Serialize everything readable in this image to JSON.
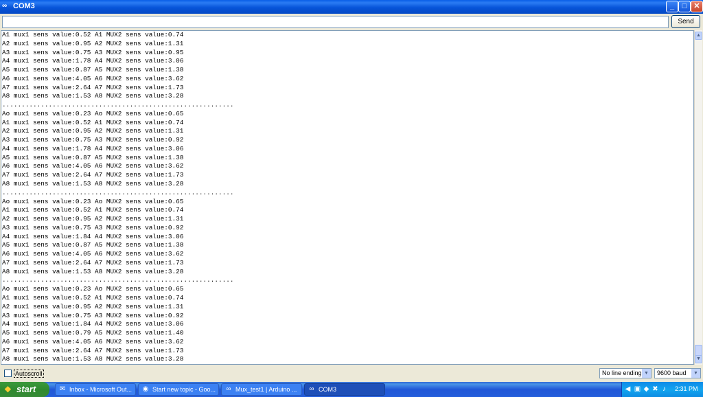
{
  "window": {
    "title": "COM3",
    "app_icon": "∞",
    "min_label": "_",
    "max_label": "□",
    "close_label": "✕"
  },
  "send_row": {
    "input_value": "",
    "send_label": "Send"
  },
  "output_lines": [
    "A1 mux1 sens value:0.52 A1 MUX2 sens value:0.74",
    "A2 mux1 sens value:0.95 A2 MUX2 sens value:1.31",
    "A3 mux1 sens value:0.75 A3 MUX2 sens value:0.95",
    "A4 mux1 sens value:1.78 A4 MUX2 sens value:3.06",
    "A5 mux1 sens value:0.87 A5 MUX2 sens value:1.38",
    "A6 mux1 sens value:4.05 A6 MUX2 sens value:3.62",
    "A7 mux1 sens value:2.64 A7 MUX2 sens value:1.73",
    "A8 mux1 sens value:1.53 A8 MUX2 sens value:3.28",
    "............................................................",
    "Ao mux1 sens value:0.23 Ao MUX2 sens value:0.65",
    "A1 mux1 sens value:0.52 A1 MUX2 sens value:0.74",
    "A2 mux1 sens value:0.95 A2 MUX2 sens value:1.31",
    "A3 mux1 sens value:0.75 A3 MUX2 sens value:0.92",
    "A4 mux1 sens value:1.78 A4 MUX2 sens value:3.06",
    "A5 mux1 sens value:0.87 A5 MUX2 sens value:1.38",
    "A6 mux1 sens value:4.05 A6 MUX2 sens value:3.62",
    "A7 mux1 sens value:2.64 A7 MUX2 sens value:1.73",
    "A8 mux1 sens value:1.53 A8 MUX2 sens value:3.28",
    "............................................................",
    "Ao mux1 sens value:0.23 Ao MUX2 sens value:0.65",
    "A1 mux1 sens value:0.52 A1 MUX2 sens value:0.74",
    "A2 mux1 sens value:0.95 A2 MUX2 sens value:1.31",
    "A3 mux1 sens value:0.75 A3 MUX2 sens value:0.92",
    "A4 mux1 sens value:1.84 A4 MUX2 sens value:3.06",
    "A5 mux1 sens value:0.87 A5 MUX2 sens value:1.38",
    "A6 mux1 sens value:4.05 A6 MUX2 sens value:3.62",
    "A7 mux1 sens value:2.64 A7 MUX2 sens value:1.73",
    "A8 mux1 sens value:1.53 A8 MUX2 sens value:3.28",
    "............................................................",
    "Ao mux1 sens value:0.23 Ao MUX2 sens value:0.65",
    "A1 mux1 sens value:0.52 A1 MUX2 sens value:0.74",
    "A2 mux1 sens value:0.95 A2 MUX2 sens value:1.31",
    "A3 mux1 sens value:0.75 A3 MUX2 sens value:0.92",
    "A4 mux1 sens value:1.84 A4 MUX2 sens value:3.06",
    "A5 mux1 sens value:0.79 A5 MUX2 sens value:1.40",
    "A6 mux1 sens value:4.05 A6 MUX2 sens value:3.62",
    "A7 mux1 sens value:2.64 A7 MUX2 sens value:1.73",
    "A8 mux1 sens value:1.53 A8 MUX2 sens value:3.28"
  ],
  "bottom_bar": {
    "autoscroll_label": "Autoscroll",
    "autoscroll_checked": false,
    "line_ending": "No line ending",
    "baud": "9600 baud"
  },
  "taskbar": {
    "start_label": "start",
    "tasks": [
      {
        "label": "Inbox - Microsoft Out...",
        "icon": "outlook-icon",
        "glyph": "✉"
      },
      {
        "label": "Start new topic - Goo...",
        "icon": "chrome-icon",
        "glyph": "◉"
      },
      {
        "label": "Mux_test1 | Arduino ...",
        "icon": "arduino-icon",
        "glyph": "∞"
      },
      {
        "label": "COM3",
        "icon": "arduino-icon",
        "glyph": "∞"
      }
    ],
    "clock": "2:31 PM"
  },
  "colors": {
    "titlebar": "#0755d9",
    "taskbar": "#245edb",
    "start": "#2f8a2f",
    "window_bg": "#ece9d8"
  }
}
